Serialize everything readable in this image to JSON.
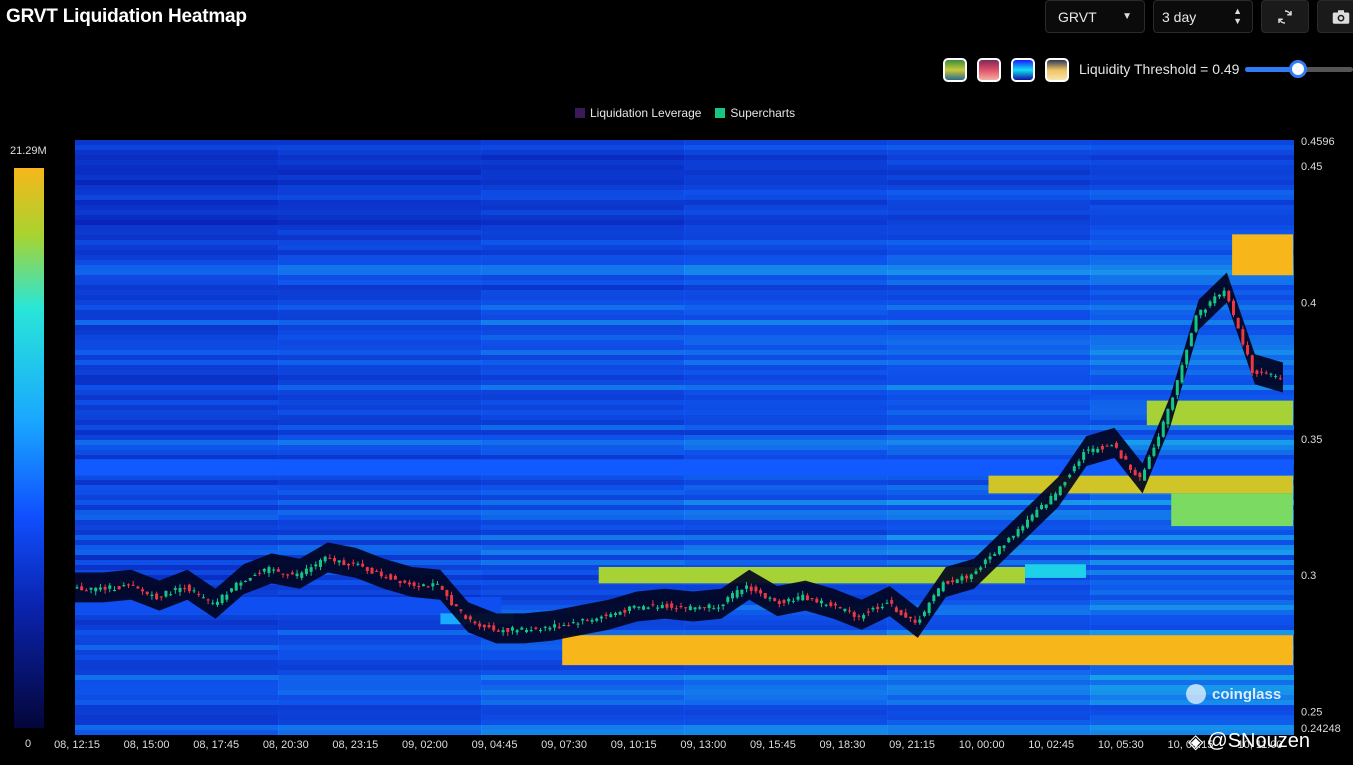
{
  "page": {
    "title": "GRVT Liquidation Heatmap"
  },
  "controls": {
    "symbol": "GRVT",
    "range": "3 day",
    "threshold_label": "Liquidity Threshold = 0.49",
    "threshold_value": 0.49,
    "refresh_icon": "refresh-icon",
    "camera_icon": "camera-icon"
  },
  "palettes": [
    "palette-1",
    "palette-2",
    "palette-3",
    "palette-4"
  ],
  "legend": {
    "items": [
      {
        "label": "Liquidation Leverage",
        "color": "#3a1a5a"
      },
      {
        "label": "Supercharts",
        "color": "#16c784"
      }
    ]
  },
  "scale": {
    "max": "21.29M",
    "min": "0"
  },
  "watermark": {
    "brand": "coinglass",
    "credit": "@SNouzen"
  },
  "chart_data": {
    "type": "heatmap",
    "title": "GRVT Liquidation Heatmap",
    "x_ticks": [
      "08, 12:15",
      "08, 15:00",
      "08, 17:45",
      "08, 20:30",
      "08, 23:15",
      "09, 02:00",
      "09, 04:45",
      "09, 07:30",
      "09, 10:15",
      "09, 13:00",
      "09, 15:45",
      "09, 18:30",
      "09, 21:15",
      "10, 00:00",
      "10, 02:45",
      "10, 05:30",
      "10, 08:15",
      "10, 11:00"
    ],
    "y_ticks": [
      0.45,
      0.4,
      0.35,
      0.3,
      0.25
    ],
    "y_top_label": "0.4596",
    "y_bottom_label": "0.24248",
    "ylim": [
      0.24248,
      0.4596
    ],
    "price_series": [
      0.295,
      0.295,
      0.296,
      0.292,
      0.296,
      0.289,
      0.298,
      0.302,
      0.3,
      0.306,
      0.304,
      0.3,
      0.297,
      0.296,
      0.284,
      0.28,
      0.28,
      0.281,
      0.283,
      0.285,
      0.288,
      0.289,
      0.288,
      0.289,
      0.296,
      0.29,
      0.292,
      0.289,
      0.285,
      0.29,
      0.282,
      0.297,
      0.3,
      0.31,
      0.32,
      0.33,
      0.345,
      0.348,
      0.335,
      0.36,
      0.395,
      0.405,
      0.375,
      0.372
    ],
    "liquidity_bands": [
      {
        "low": 0.3365,
        "high": 0.3425,
        "from": 0.0,
        "to": 1.0,
        "intensity": 0.45
      },
      {
        "low": 0.33,
        "high": 0.3365,
        "from": 0.75,
        "to": 1.0,
        "intensity": 0.95
      },
      {
        "low": 0.297,
        "high": 0.303,
        "from": 0.43,
        "to": 0.78,
        "intensity": 0.9
      },
      {
        "low": 0.299,
        "high": 0.304,
        "from": 0.78,
        "to": 0.83,
        "intensity": 0.7
      },
      {
        "low": 0.267,
        "high": 0.278,
        "from": 0.4,
        "to": 1.0,
        "intensity": 1.0
      },
      {
        "low": 0.41,
        "high": 0.425,
        "from": 0.95,
        "to": 1.0,
        "intensity": 1.0
      },
      {
        "low": 0.355,
        "high": 0.364,
        "from": 0.88,
        "to": 1.0,
        "intensity": 0.9
      },
      {
        "low": 0.318,
        "high": 0.33,
        "from": 0.9,
        "to": 1.0,
        "intensity": 0.85
      },
      {
        "low": 0.286,
        "high": 0.292,
        "from": 0.0,
        "to": 0.35,
        "intensity": 0.4
      },
      {
        "low": 0.282,
        "high": 0.286,
        "from": 0.3,
        "to": 0.36,
        "intensity": 0.6
      }
    ]
  }
}
